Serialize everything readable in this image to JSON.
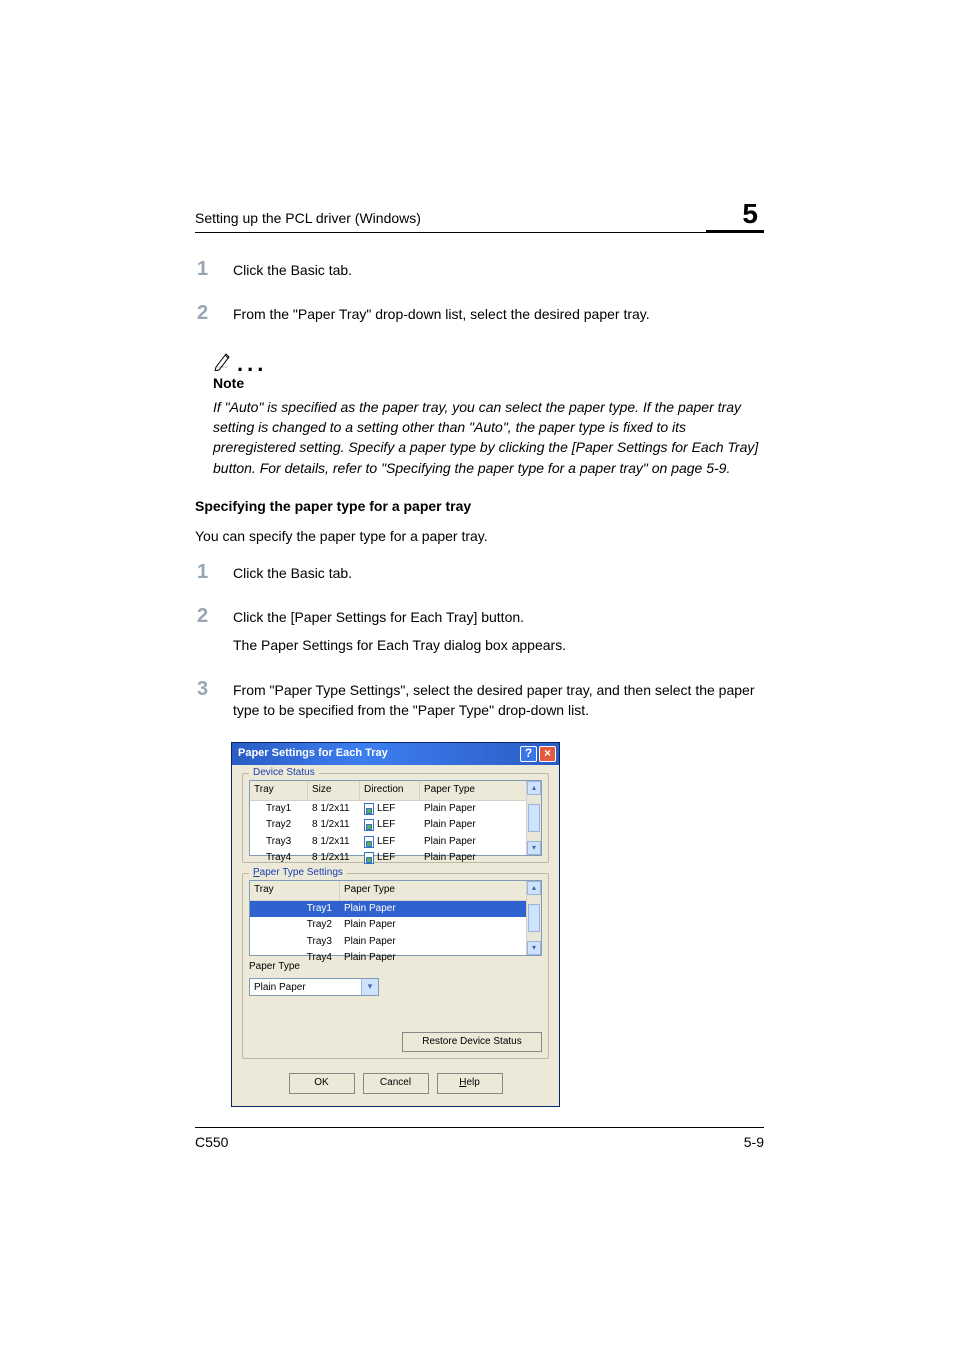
{
  "header": {
    "title": "Setting up the PCL driver (Windows)",
    "chapter_number": "5"
  },
  "steps_top": {
    "s1_num": "1",
    "s1_text": "Click the Basic tab.",
    "s2_num": "2",
    "s2_text": "From the \"Paper Tray\" drop-down list, select the desired paper tray."
  },
  "note": {
    "title": "Note",
    "body": "If \"Auto\" is specified as the paper tray, you can select the paper type. If the paper tray setting is changed to a setting other than \"Auto\", the paper type is fixed to its preregistered setting. Specify a paper type by clicking the [Paper Settings for Each Tray] button. For details, refer to \"Specifying the paper type for a paper tray\" on page 5-9."
  },
  "section": {
    "heading": "Specifying the paper type for a paper tray",
    "intro": "You can specify the paper type for a paper tray."
  },
  "steps_bottom": {
    "s1_num": "1",
    "s1_text": "Click the Basic tab.",
    "s2_num": "2",
    "s2_text": "Click the [Paper Settings for Each Tray] button.",
    "s2_text2": "The Paper Settings for Each Tray dialog box appears.",
    "s3_num": "3",
    "s3_text": "From \"Paper Type Settings\", select the desired paper tray, and then select the paper type to be specified from the \"Paper Type\" drop-down list."
  },
  "dialog": {
    "title": "Paper Settings for Each Tray",
    "help_glyph": "?",
    "close_glyph": "×",
    "group_device": "Device Status",
    "group_types": "Paper Type Settings",
    "cols": {
      "tray": "Tray",
      "size": "Size",
      "direction": "Direction",
      "ptype": "Paper Type"
    },
    "device_rows": [
      {
        "tray": "Tray1",
        "size": "8 1/2x11",
        "dir": "LEF",
        "ptype": "Plain Paper"
      },
      {
        "tray": "Tray2",
        "size": "8 1/2x11",
        "dir": "LEF",
        "ptype": "Plain Paper"
      },
      {
        "tray": "Tray3",
        "size": "8 1/2x11",
        "dir": "LEF",
        "ptype": "Plain Paper"
      },
      {
        "tray": "Tray4",
        "size": "8 1/2x11",
        "dir": "LEF",
        "ptype": "Plain Paper"
      }
    ],
    "type_cols": {
      "tray": "Tray",
      "ptype": "Paper Type"
    },
    "type_rows": [
      {
        "tray": "Tray1",
        "ptype": "Plain Paper",
        "selected": true
      },
      {
        "tray": "Tray2",
        "ptype": "Plain Paper"
      },
      {
        "tray": "Tray3",
        "ptype": "Plain Paper"
      },
      {
        "tray": "Tray4",
        "ptype": "Plain Paper"
      }
    ],
    "paper_type_label": "Paper Type",
    "paper_type_value": "Plain Paper",
    "restore_btn": "Restore Device Status",
    "ok_btn": "OK",
    "cancel_btn": "Cancel",
    "help_btn": "Help"
  },
  "footer": {
    "left": "C550",
    "right": "5-9"
  }
}
